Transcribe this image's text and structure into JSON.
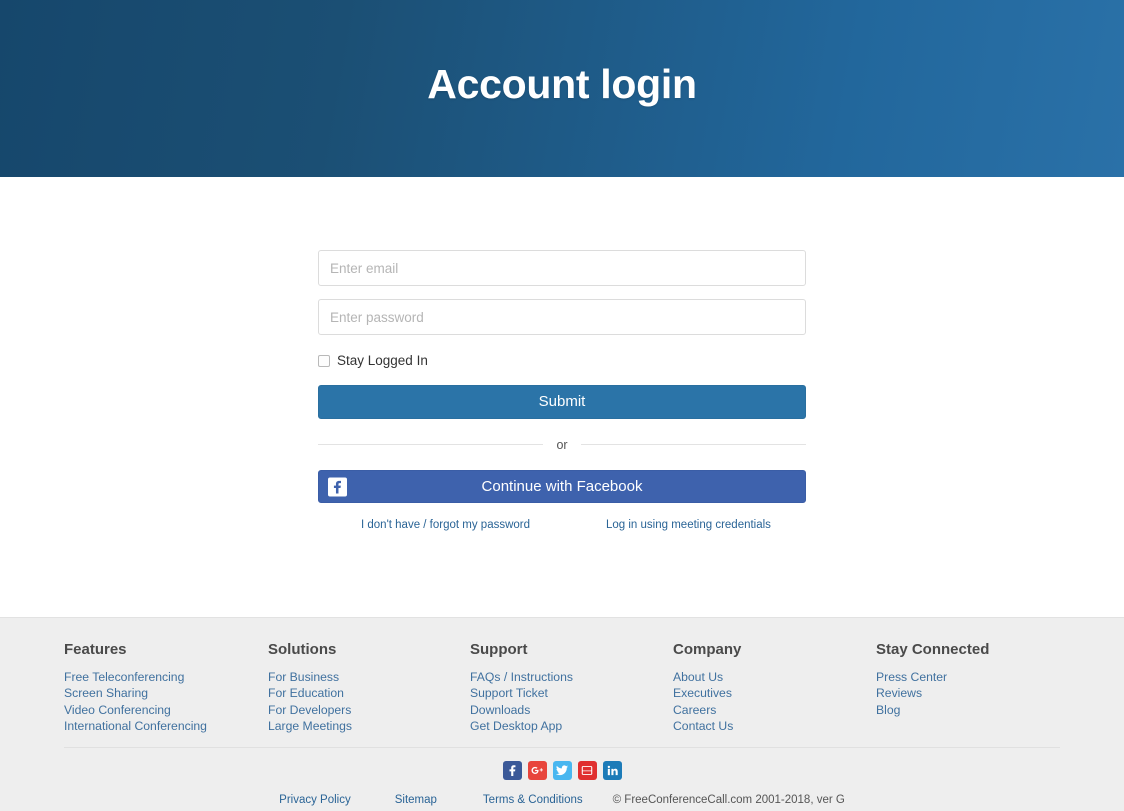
{
  "hero": {
    "title": "Account login",
    "gradient_from": "#16476c",
    "gradient_to": "#2a71a8"
  },
  "form": {
    "email_value": "",
    "email_placeholder": "Enter email",
    "password_value": "",
    "password_placeholder": "Enter password",
    "stay_logged_in_label": "Stay Logged In",
    "stay_logged_in_checked": false,
    "submit_label": "Submit",
    "divider_label": "or",
    "facebook_label": "Continue with Facebook",
    "facebook_icon": "facebook-icon",
    "facebook_color": "#3e62ad",
    "submit_color": "#2b74a8",
    "forgot_password_label": "I don't have / forgot my password",
    "meeting_credentials_label": "Log in using meeting credentials",
    "link_color": "#2a6496"
  },
  "footer": {
    "columns": [
      {
        "title": "Features",
        "links": [
          "Free Teleconferencing",
          "Screen Sharing",
          "Video Conferencing",
          "International Conferencing"
        ]
      },
      {
        "title": "Solutions",
        "links": [
          "For Business",
          "For Education",
          "For Developers",
          "Large Meetings"
        ]
      },
      {
        "title": "Support",
        "links": [
          "FAQs / Instructions",
          "Support Ticket",
          "Downloads",
          "Get Desktop App"
        ]
      },
      {
        "title": "Company",
        "links": [
          "About Us",
          "Executives",
          "Careers",
          "Contact Us"
        ]
      },
      {
        "title": "Stay Connected",
        "links": [
          "Press Center",
          "Reviews",
          "Blog"
        ]
      }
    ],
    "social": [
      {
        "name": "facebook-icon",
        "label": "f",
        "color": "#3b5998"
      },
      {
        "name": "google-plus-icon",
        "label": "G+",
        "color": "#e8453c"
      },
      {
        "name": "twitter-icon",
        "label": "t",
        "color": "#49b7f0"
      },
      {
        "name": "youtube-icon",
        "label": "You Tube",
        "color": "#e02f2f"
      },
      {
        "name": "linkedin-icon",
        "label": "in",
        "color": "#1c7bb8"
      }
    ],
    "bottom": {
      "privacy_policy": "Privacy Policy",
      "sitemap": "Sitemap",
      "terms": "Terms & Conditions",
      "copyright": "© FreeConferenceCall.com 2001-2018, ver G"
    }
  }
}
